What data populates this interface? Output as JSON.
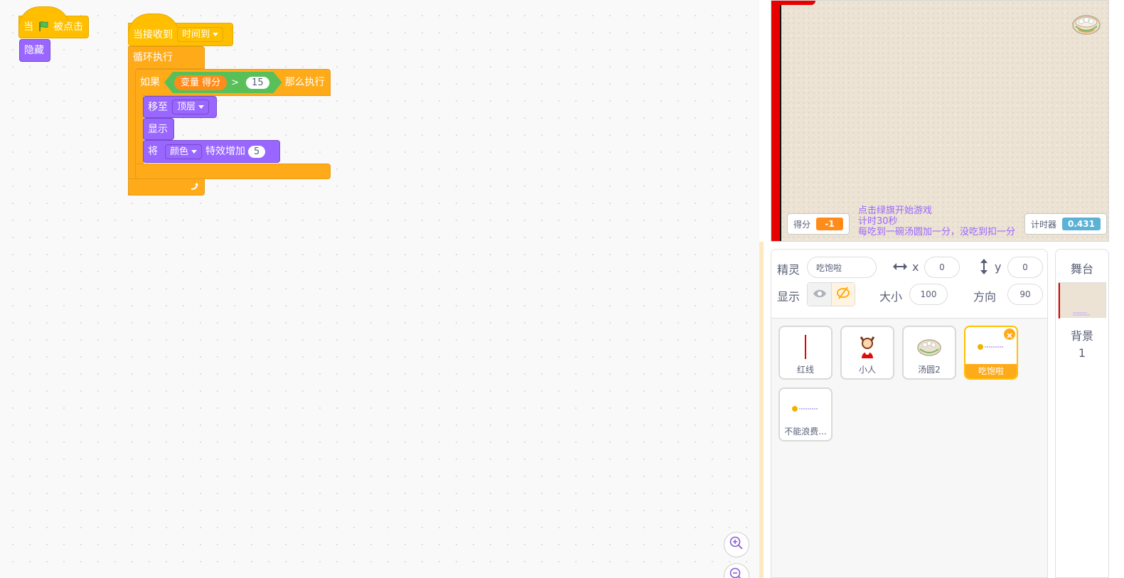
{
  "scripts": {
    "script1": {
      "hat_when": "当",
      "hat_clicked": "被点击",
      "hide": "隐藏"
    },
    "script2": {
      "hat_receive": "当接收到",
      "message": "时间到",
      "forever": "循环执行",
      "if": "如果",
      "var_reporter": "变量 得分",
      "gt": ">",
      "threshold": "15",
      "then": "那么执行",
      "go_to": "移至",
      "layer": "顶层",
      "show": "显示",
      "change_prefix": "将",
      "effect": "颜色",
      "change_suffix": "特效增加",
      "amount": "5"
    }
  },
  "stage": {
    "score_label": "得分",
    "score_value": "-1",
    "timer_label": "计时器",
    "timer_value": "0.431",
    "instructions": [
      "点击绿旗开始游戏",
      "计时30秒",
      "每吃到一碗汤圆加一分，没吃到扣一分"
    ]
  },
  "sprite_info": {
    "sprite_label": "精灵",
    "sprite_name": "吃饱啦",
    "x_label": "x",
    "x_value": "0",
    "y_label": "y",
    "y_value": "0",
    "show_label": "显示",
    "size_label": "大小",
    "size_value": "100",
    "direction_label": "方向",
    "direction_value": "90"
  },
  "sprites": [
    {
      "name": "红线"
    },
    {
      "name": "小人"
    },
    {
      "name": "汤圆2"
    },
    {
      "name": "吃饱啦",
      "selected": true
    },
    {
      "name": "不能浪费..."
    }
  ],
  "stage_panel": {
    "title": "舞台",
    "backdrop_label": "背景",
    "backdrop_count": "1"
  },
  "colors": {
    "events": "#ffbf00",
    "control": "#ffab19",
    "looks": "#9966ff",
    "operators": "#59c059",
    "variables": "#ff8c1a",
    "timer_monitor": "#5cb1d6"
  },
  "icons": [
    "green-flag-icon",
    "eye-icon",
    "eye-off-icon",
    "zoom-in-icon",
    "zoom-out-icon",
    "delete-icon",
    "loop-arrow-icon",
    "horizontal-arrows-icon",
    "vertical-arrows-icon"
  ]
}
